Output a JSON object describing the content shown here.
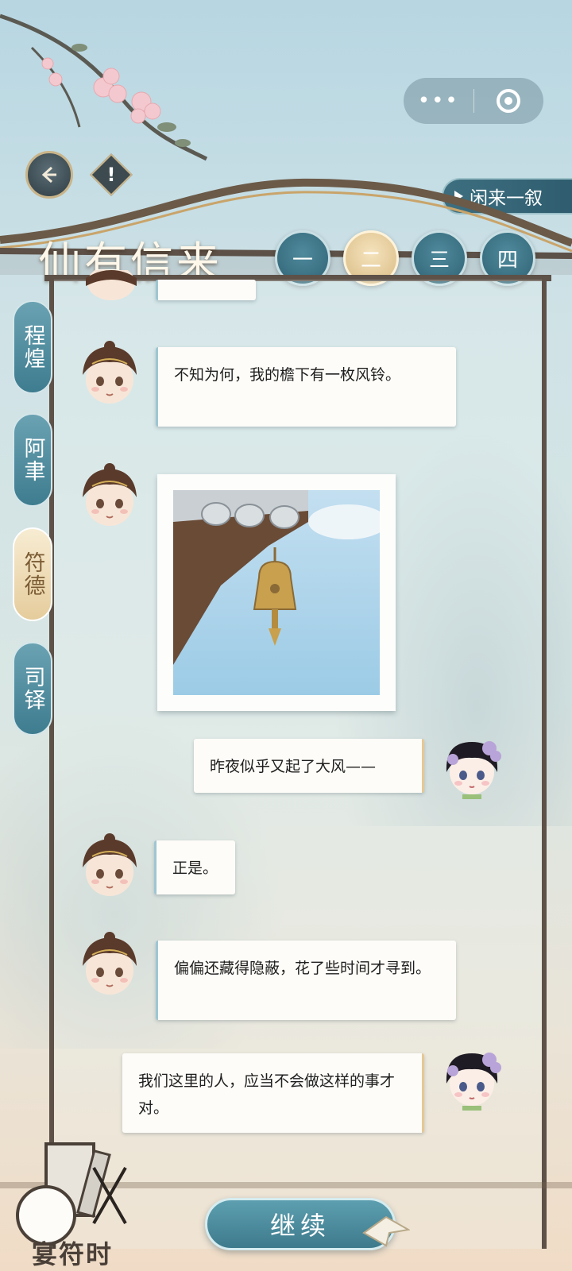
{
  "top_bar": {
    "more_icon": "more-dots-icon",
    "record_icon": "target-record-icon"
  },
  "nav": {
    "back_icon": "back-arrow-icon",
    "info_label": "!"
  },
  "header": {
    "title": "仙有信来",
    "chat_button": "闲来一叙",
    "chapters": [
      "一",
      "二",
      "三",
      "四"
    ],
    "active_chapter": 1
  },
  "sidebar": {
    "contacts": [
      "程煌",
      "阿聿",
      "符德",
      "司铎"
    ],
    "active_contact": 2
  },
  "messages": [
    {
      "side": "left",
      "text": "不知为何，我的檐下有一枚风铃。"
    },
    {
      "side": "left",
      "type": "image",
      "alt": "bell-under-eaves-photo"
    },
    {
      "side": "right",
      "text": "昨夜似乎又起了大风——"
    },
    {
      "side": "left",
      "text": "正是。"
    },
    {
      "side": "left",
      "text": "偏偏还藏得隐蔽，花了些时间才寻到。"
    },
    {
      "side": "right",
      "text": "我们这里的人，应当不会做这样的事才对。"
    }
  ],
  "footer": {
    "continue_label": "继续",
    "studio_name": "宴符时"
  },
  "colors": {
    "accent": "#3d7a8c",
    "active_tab": "#e5cc9c",
    "frame": "#5d5148"
  }
}
